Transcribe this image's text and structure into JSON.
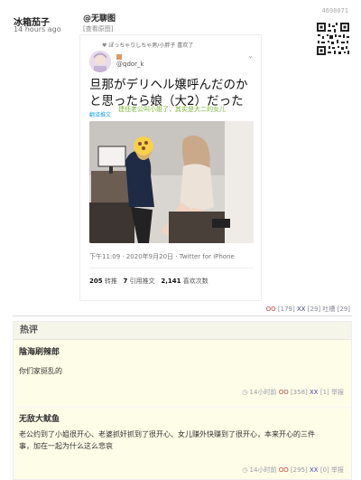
{
  "post": {
    "author": "冰箱茄子",
    "time": "14 hours ago",
    "post_id": "4698071",
    "tag": "@无聊图",
    "view_original": "[查看原图]",
    "actions": {
      "oo_label": "OO",
      "oo_count": "[179]",
      "xx_label": "XX",
      "xx_count": "[29]",
      "spit_label": "吐槽",
      "spit_count": "[29]"
    }
  },
  "tweet": {
    "retweeted_by": "ぽっちゃりしちゃ男/小胖子 喜欢了",
    "handle": "@qdor_k",
    "text": "旦那がデリヘル嬢呼んだのかと思ったら娘（大2）だった",
    "translate_label": "翻译推文",
    "translation": "建任老公叫小姐了，其实是大二的女儿",
    "meta": "下午11:09 · 2020年9月20日 · Twitter for iPhone",
    "stats": {
      "retweets_num": "205",
      "retweets_label": "转推",
      "quotes_num": "7",
      "quotes_label": "引用推文",
      "likes_num": "2,141",
      "likes_label": "喜欢次数"
    }
  },
  "hot_comments": {
    "title": "热评",
    "items": [
      {
        "author": "陰海刷辣郎",
        "text": "你们家挺乱的",
        "time": "14小时前",
        "oo_label": "OO",
        "oo_count": "[358]",
        "xx_label": "XX",
        "xx_count": "[1]",
        "report": "举报"
      },
      {
        "author": "无敌大鱿鱼",
        "text": "老公约到了小姐很开心、老婆抓奸抓到了很开心、女儿赚外快赚到了很开心，本来开心的三件事，加在一起为什么这么悲哀",
        "time": "14小时前",
        "oo_label": "OO",
        "oo_count": "[295]",
        "xx_label": "XX",
        "xx_count": "[0]",
        "report": "举报"
      }
    ]
  },
  "colors": {
    "oo": "#cc4444",
    "xx": "#4444aa",
    "link": "#1da1f2",
    "translation": "#7db83a",
    "comment_bg": "#fefee8"
  }
}
